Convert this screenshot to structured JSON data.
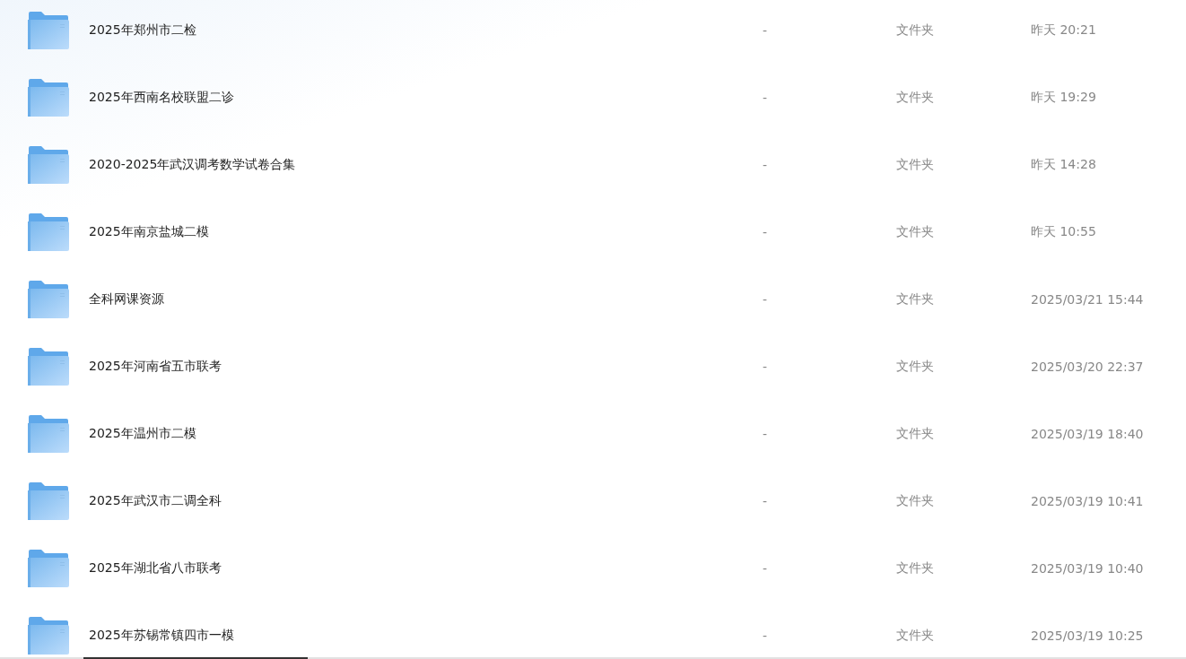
{
  "files": [
    {
      "name": "2025年郑州市二检",
      "size": "-",
      "type": "文件夹",
      "modified": "昨天 20:21"
    },
    {
      "name": "2025年西南名校联盟二诊",
      "size": "-",
      "type": "文件夹",
      "modified": "昨天 19:29"
    },
    {
      "name": "2020-2025年武汉调考数学试卷合集",
      "size": "-",
      "type": "文件夹",
      "modified": "昨天 14:28"
    },
    {
      "name": "2025年南京盐城二模",
      "size": "-",
      "type": "文件夹",
      "modified": "昨天 10:55"
    },
    {
      "name": "全科网课资源",
      "size": "-",
      "type": "文件夹",
      "modified": "2025/03/21 15:44"
    },
    {
      "name": "2025年河南省五市联考",
      "size": "-",
      "type": "文件夹",
      "modified": "2025/03/20 22:37"
    },
    {
      "name": "2025年温州市二模",
      "size": "-",
      "type": "文件夹",
      "modified": "2025/03/19 18:40"
    },
    {
      "name": "2025年武汉市二调全科",
      "size": "-",
      "type": "文件夹",
      "modified": "2025/03/19 10:41"
    },
    {
      "name": "2025年湖北省八市联考",
      "size": "-",
      "type": "文件夹",
      "modified": "2025/03/19 10:40"
    },
    {
      "name": "2025年苏锡常镇四市一模",
      "size": "-",
      "type": "文件夹",
      "modified": "2025/03/19 10:25"
    }
  ]
}
